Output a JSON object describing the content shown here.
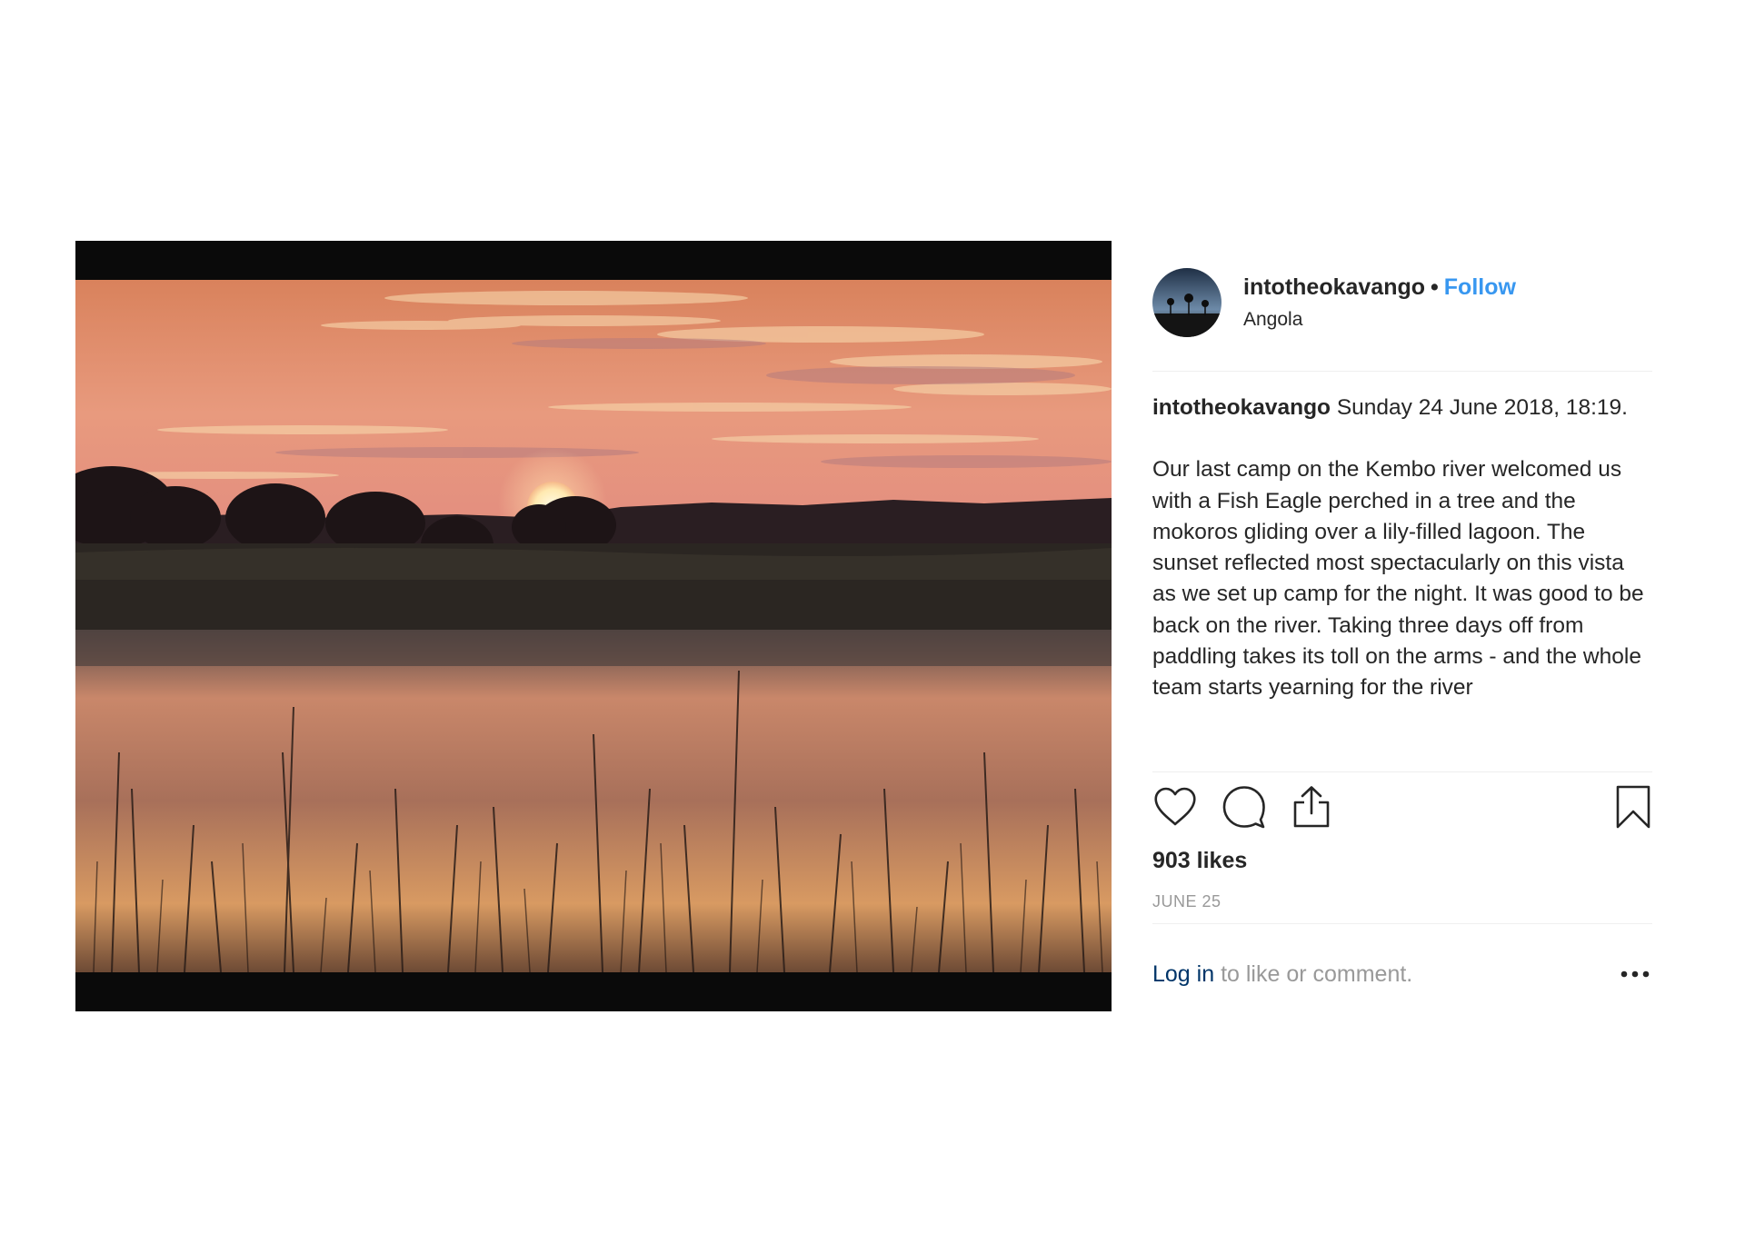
{
  "post": {
    "username": "intotheokavango",
    "separator": "•",
    "follow_label": "Follow",
    "location": "Angola",
    "caption": {
      "username": "intotheokavango",
      "date_text": "Sunday 24 June 2018, 18:19.",
      "body": "Our last camp on the Kembo river welcomed us with a Fish Eagle perched in a tree and the mokoros gliding over a lily-filled lagoon. The sunset reflected most spectacularly on this vista as we set up camp for the night. It was good to be back on the river. Taking three days off from paddling takes its toll on the arms - and the whole team starts yearning for the river"
    },
    "likes": "903 likes",
    "date": "JUNE 25",
    "login_link": "Log in",
    "login_rest": " to like or comment.",
    "icons": {
      "like": "heart-icon",
      "comment": "comment-icon",
      "share": "share-icon",
      "save": "bookmark-icon",
      "more": "more-options-icon"
    },
    "colors": {
      "follow": "#3897f0",
      "login_link": "#003569",
      "muted": "#999999",
      "text": "#262626"
    }
  }
}
